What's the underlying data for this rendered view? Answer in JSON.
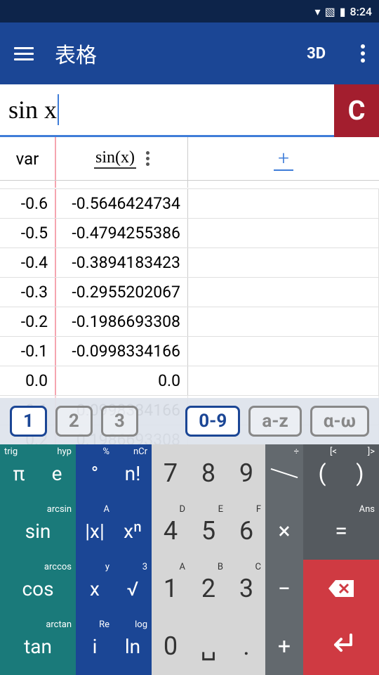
{
  "status": {
    "time": "8:24"
  },
  "appbar": {
    "title": "表格",
    "btn3d": "3D"
  },
  "input": {
    "value": "sin x",
    "clear": "C"
  },
  "table": {
    "header": {
      "var": "var",
      "func": "sin(x)",
      "add": "+"
    },
    "rows": [
      {
        "var": "-0.6",
        "val": "-0.5646424734"
      },
      {
        "var": "-0.5",
        "val": "-0.4794255386"
      },
      {
        "var": "-0.4",
        "val": "-0.3894183423"
      },
      {
        "var": "-0.3",
        "val": "-0.2955202067"
      },
      {
        "var": "-0.2",
        "val": "-0.1986693308"
      },
      {
        "var": "-0.1",
        "val": "-0.0998334166"
      },
      {
        "var": "0.0",
        "val": "0.0"
      }
    ],
    "partial_rows": [
      {
        "var": "0.1",
        "val": "0.0998334166"
      },
      {
        "var": "0.2",
        "val": "0.1986693308"
      }
    ]
  },
  "modes": {
    "m1": "1",
    "m2": "2",
    "m3": "3",
    "r1": "0-9",
    "r2": "a-z",
    "r3": "α-ω"
  },
  "keys": {
    "pi": "π",
    "pi_sup": "trig",
    "e": "e",
    "e_sup": "hyp",
    "deg": "°",
    "deg_sup": "%",
    "fact": "n!",
    "fact_sup": "nCr",
    "n7": "7",
    "n8": "8",
    "n9": "9",
    "frac_sup": "÷",
    "lpar": "(",
    "lpar_sup": "[<",
    "rpar": ")",
    "rpar_sup": "]>",
    "sin": "sin",
    "sin_sup": "arcsin",
    "abs": "|x|",
    "abs_sup": "A",
    "pow": "xⁿ",
    "n4": "4",
    "n4_sup": "D",
    "n5": "5",
    "n5_sup": "E",
    "n6": "6",
    "n6_sup": "F",
    "mul": "×",
    "eq": "=",
    "eq_sup": "Ans",
    "cos": "cos",
    "cos_sup": "arccos",
    "x": "x",
    "x_sup": "y",
    "sqrt": "√",
    "sqrt_sup": "3",
    "n1": "1",
    "n1_sup": "A",
    "n2": "2",
    "n2_sup": "B",
    "n3": "3",
    "n3_sup": "C",
    "sub": "−",
    "tan": "tan",
    "tan_sup": "arctan",
    "i": "i",
    "i_sup": "Re",
    "ln": "ln",
    "ln_sup": "log",
    "n0": "0",
    "spc": "␣",
    "dot": ".",
    "add": "+"
  }
}
